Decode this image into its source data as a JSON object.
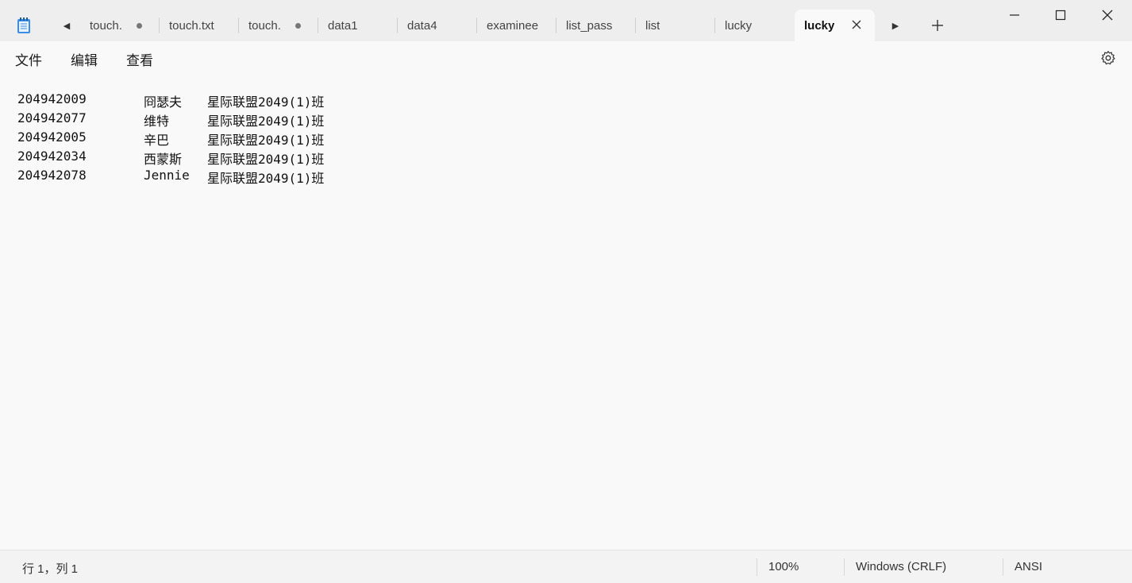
{
  "tabs": [
    {
      "label": "touch.",
      "modified": true
    },
    {
      "label": "touch.txt",
      "modified": false
    },
    {
      "label": "touch.",
      "modified": true
    },
    {
      "label": "data1",
      "modified": false
    },
    {
      "label": "data4",
      "modified": false
    },
    {
      "label": "examinee",
      "modified": false
    },
    {
      "label": "list_pass",
      "modified": false
    },
    {
      "label": "list",
      "modified": false
    },
    {
      "label": "lucky",
      "modified": false
    },
    {
      "label": "lucky",
      "active": true
    }
  ],
  "menu": {
    "file": "文件",
    "edit": "编辑",
    "view": "查看"
  },
  "document": {
    "lines": [
      {
        "id": "204942009",
        "name": "冏瑟夫",
        "class": "星际联盟2049(1)班"
      },
      {
        "id": "204942077",
        "name": "维特",
        "class": "星际联盟2049(1)班"
      },
      {
        "id": "204942005",
        "name": "辛巴",
        "class": "星际联盟2049(1)班"
      },
      {
        "id": "204942034",
        "name": "西蒙斯",
        "class": "星际联盟2049(1)班"
      },
      {
        "id": "204942078",
        "name": "Jennie",
        "class": "星际联盟2049(1)班"
      }
    ]
  },
  "status": {
    "position": "行 1，列 1",
    "zoom": "100%",
    "line_ending": "Windows (CRLF)",
    "encoding": "ANSI"
  },
  "icons": {
    "app": "notepad-icon",
    "scroll_left": "caret-left-icon",
    "scroll_right": "caret-right-icon",
    "add": "plus-icon",
    "close_tab": "close-icon",
    "settings": "gear-icon"
  }
}
